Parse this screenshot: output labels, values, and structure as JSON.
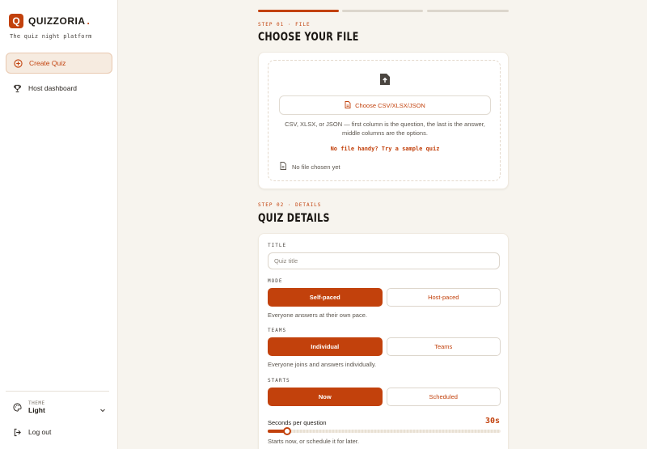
{
  "brand": {
    "logo_letter": "Q",
    "name": "QUIZZORIA",
    "dot": ".",
    "tagline": "The quiz night platform"
  },
  "sidebar": {
    "items": [
      {
        "label": "Create Quiz",
        "icon": "plus-circle-icon",
        "active": true
      },
      {
        "label": "Host dashboard",
        "icon": "trophy-icon",
        "active": false
      }
    ],
    "theme": {
      "label": "THEME",
      "value": "Light"
    },
    "logout": "Log out"
  },
  "steps": {
    "total": 3,
    "current": 1
  },
  "step1": {
    "eyebrow": "STEP 01 · FILE",
    "title": "CHOOSE YOUR FILE",
    "choose_button": "Choose CSV/XLSX/JSON",
    "description": "CSV, XLSX, or JSON — first column is the question, the last is the answer, middle columns are the options.",
    "sample_link": "No file handy? Try a sample quiz",
    "file_status": "No file chosen yet"
  },
  "step2": {
    "eyebrow": "STEP 02 · DETAILS",
    "title": "QUIZ DETAILS",
    "title_label": "TITLE",
    "title_placeholder": "Quiz title",
    "mode": {
      "label": "MODE",
      "options": [
        "Self-paced",
        "Host-paced"
      ],
      "selected": "Self-paced",
      "help": "Everyone answers at their own pace."
    },
    "teams": {
      "label": "TEAMS",
      "options": [
        "Individual",
        "Teams"
      ],
      "selected": "Individual",
      "help": "Everyone joins and answers individually."
    },
    "starts": {
      "label": "STARTS",
      "options": [
        "Now",
        "Scheduled"
      ],
      "selected": "Now",
      "help": "Starts now, or schedule it for later."
    },
    "seconds": {
      "label": "Seconds per question",
      "value_text": "30s",
      "value": 30,
      "slider_fraction": 0.07
    }
  },
  "colors": {
    "accent": "#c2410c",
    "background": "#f7f4ee",
    "card": "#ffffff"
  }
}
